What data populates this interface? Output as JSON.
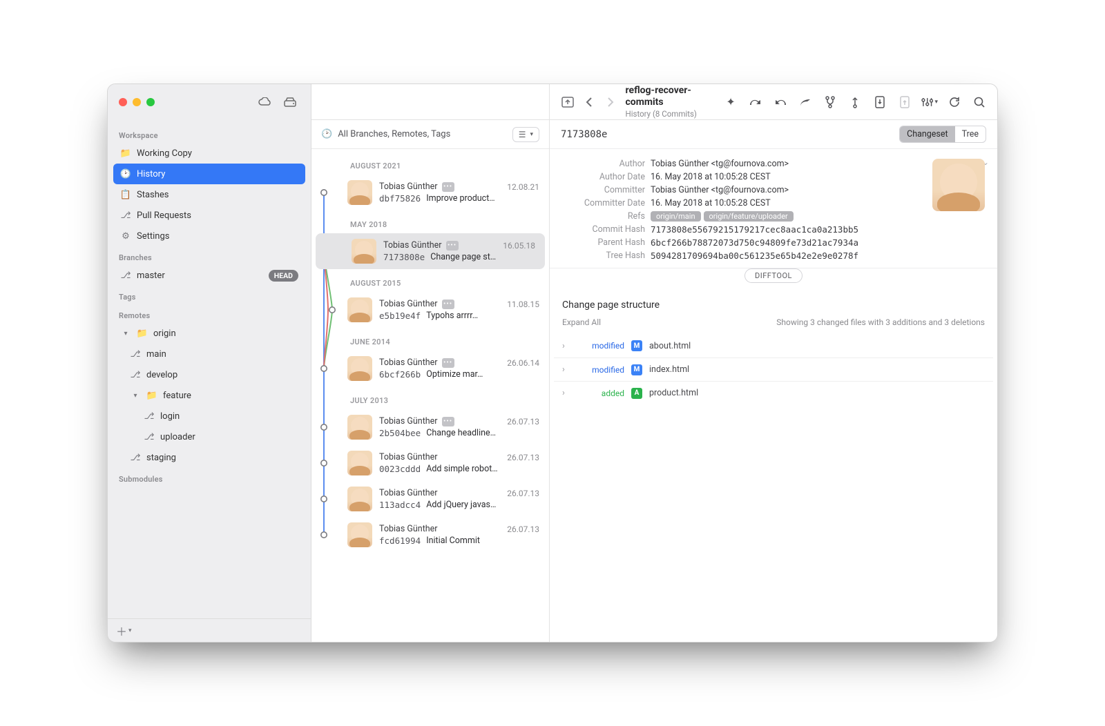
{
  "repo": {
    "title": "reflog-recover-commits",
    "subtitle": "History (8 Commits)"
  },
  "sidebar": {
    "sections": {
      "workspace": "Workspace",
      "branches": "Branches",
      "tags": "Tags",
      "remotes": "Remotes",
      "submodules": "Submodules"
    },
    "workspace": [
      {
        "label": "Working Copy"
      },
      {
        "label": "History"
      },
      {
        "label": "Stashes"
      },
      {
        "label": "Pull Requests"
      },
      {
        "label": "Settings"
      }
    ],
    "branch": {
      "name": "master",
      "badge": "HEAD"
    },
    "remote": {
      "name": "origin",
      "children": [
        {
          "label": "main"
        },
        {
          "label": "develop"
        },
        {
          "label": "feature",
          "children": [
            {
              "label": "login"
            },
            {
              "label": "uploader"
            }
          ]
        },
        {
          "label": "staging"
        }
      ]
    }
  },
  "filter": {
    "label": "All Branches, Remotes, Tags"
  },
  "history": {
    "groups": [
      {
        "label": "AUGUST 2021",
        "commits": [
          {
            "author": "Tobias Günther",
            "date": "12.08.21",
            "hash": "dbf75826",
            "msg": "Improve product…",
            "tagged": true
          }
        ]
      },
      {
        "label": "MAY 2018",
        "commits": [
          {
            "author": "Tobias Günther",
            "date": "16.05.18",
            "hash": "7173808e",
            "msg": "Change page st…",
            "tagged": true,
            "selected": true
          }
        ]
      },
      {
        "label": "AUGUST 2015",
        "commits": [
          {
            "author": "Tobias Günther",
            "date": "11.08.15",
            "hash": "e5b19e4f",
            "msg": "Typohs arrrr…",
            "tagged": true
          }
        ]
      },
      {
        "label": "JUNE 2014",
        "commits": [
          {
            "author": "Tobias Günther",
            "date": "26.06.14",
            "hash": "6bcf266b",
            "msg": "Optimize mar…",
            "tagged": true
          }
        ]
      },
      {
        "label": "JULY 2013",
        "commits": [
          {
            "author": "Tobias Günther",
            "date": "26.07.13",
            "hash": "2b504bee",
            "msg": "Change headline…",
            "tagged": true
          },
          {
            "author": "Tobias Günther",
            "date": "26.07.13",
            "hash": "0023cddd",
            "msg": "Add simple robot…"
          },
          {
            "author": "Tobias Günther",
            "date": "26.07.13",
            "hash": "113adcc4",
            "msg": "Add jQuery javas…"
          },
          {
            "author": "Tobias Günther",
            "date": "26.07.13",
            "hash": "fcd61994",
            "msg": "Initial Commit"
          }
        ]
      }
    ]
  },
  "detail": {
    "short_hash": "7173808e",
    "seg": {
      "changeset": "Changeset",
      "tree": "Tree"
    },
    "meta": {
      "Author": "Tobias Günther <tg@fournova.com>",
      "Author Date": "16. May 2018 at 10:05:28 CEST",
      "Committer": "Tobias Günther <tg@fournova.com>",
      "Committer Date": "16. May 2018 at 10:05:28 CEST",
      "refs": [
        "origin/main",
        "origin/feature/uploader"
      ],
      "Commit Hash": "7173808e55679215179217cec8aac1ca0a213bb5",
      "Parent Hash": "6bcf266b78872073d750c94809fe73d21ac7934a",
      "Tree Hash": "5094281709694ba00c561235e65b42e2e9e0278f"
    },
    "labels": {
      "Author": "Author",
      "Author Date": "Author Date",
      "Committer": "Committer",
      "Committer Date": "Committer Date",
      "Refs": "Refs",
      "Commit Hash": "Commit Hash",
      "Parent Hash": "Parent Hash",
      "Tree Hash": "Tree Hash"
    },
    "difftool": "DIFFTOOL",
    "title": "Change page structure",
    "expand": "Expand All",
    "stats": "Showing 3 changed files with 3 additions and 3 deletions",
    "files": [
      {
        "status": "modified",
        "kind": "M",
        "name": "about.html"
      },
      {
        "status": "modified",
        "kind": "M",
        "name": "index.html"
      },
      {
        "status": "added",
        "kind": "A",
        "name": "product.html"
      }
    ]
  }
}
